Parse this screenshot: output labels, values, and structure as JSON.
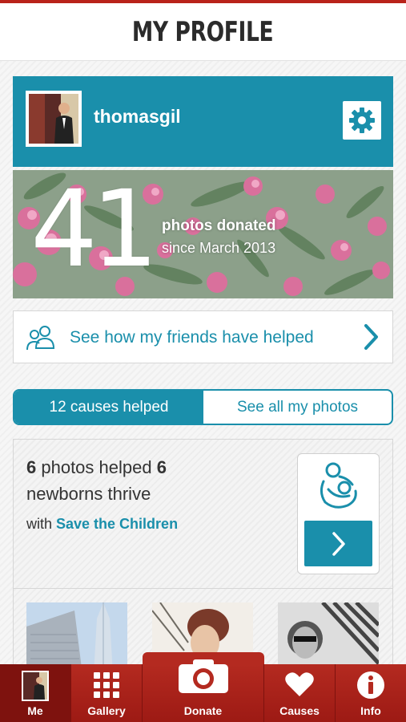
{
  "header": {
    "title": "MY PROFILE"
  },
  "profile": {
    "username": "thomasgil"
  },
  "stats": {
    "photos_count": "41",
    "photos_label": "photos donated",
    "since_label": "since March 2013"
  },
  "friends": {
    "label": "See how my friends have helped"
  },
  "segment": {
    "causes_label": "12 causes helped",
    "photos_label": "See all my photos"
  },
  "cause": {
    "count_a": "6",
    "text_a": " photos helped ",
    "count_b": "6",
    "text_b": "newborns thrive",
    "with_label": "with ",
    "org": "Save the Children"
  },
  "tabs": {
    "me": "Me",
    "gallery": "Gallery",
    "donate": "Donate",
    "causes": "Causes",
    "info": "Info"
  },
  "colors": {
    "accent": "#1a8fab",
    "brand_red": "#b42a20"
  },
  "icons": {
    "settings": "gear-icon",
    "friends": "friends-icon",
    "chevron": "chevron-right-icon",
    "cause": "mother-baby-icon",
    "gallery": "grid-icon",
    "donate": "camera-icon",
    "causes": "heart-icon",
    "info": "info-icon"
  }
}
